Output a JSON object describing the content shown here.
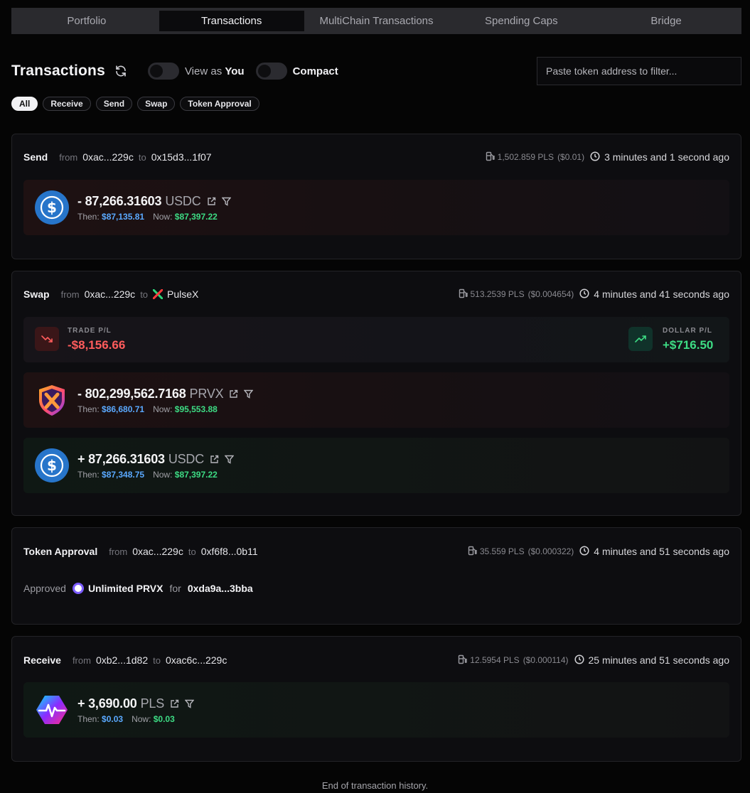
{
  "tabs": [
    {
      "label": "Portfolio",
      "active": false
    },
    {
      "label": "Transactions",
      "active": true
    },
    {
      "label": "MultiChain Transactions",
      "active": false
    },
    {
      "label": "Spending Caps",
      "active": false
    },
    {
      "label": "Bridge",
      "active": false
    }
  ],
  "header": {
    "title": "Transactions",
    "toggle_view_as_prefix": "View as ",
    "toggle_view_as_bold": "You",
    "toggle_compact": "Compact",
    "filter_placeholder": "Paste token address to filter..."
  },
  "filters": [
    {
      "label": "All",
      "active": true
    },
    {
      "label": "Receive",
      "active": false
    },
    {
      "label": "Send",
      "active": false
    },
    {
      "label": "Swap",
      "active": false
    },
    {
      "label": "Token Approval",
      "active": false
    }
  ],
  "labels": {
    "from": "from",
    "to": "to",
    "then": "Then:",
    "now": "Now:"
  },
  "colors": {
    "then": "#5aa9ff",
    "now": "#3ddc84",
    "negative": "#ff5c5c",
    "positive": "#3ddc84",
    "usdc": "#2775ca"
  },
  "transactions": [
    {
      "type": "Send",
      "from": "0xac...229c",
      "to": "0x15d3...1f07",
      "gas": "1,502.859 PLS",
      "gas_usd": "($0.01)",
      "time": "3 minutes and 1 second ago",
      "tokens": [
        {
          "amount": "- 87,266.31603",
          "symbol": "USDC",
          "then": "$87,135.81",
          "now": "$87,397.22",
          "icon": "usdc-icon"
        }
      ]
    },
    {
      "type": "Swap",
      "from": "0xac...229c",
      "to": "PulseX",
      "gas": "513.2539 PLS",
      "gas_usd": "($0.004654)",
      "time": "4 minutes and 41 seconds ago",
      "trade_pl_label": "TRADE P/L",
      "trade_pl": "-$8,156.66",
      "dollar_pl_label": "DOLLAR P/L",
      "dollar_pl": "+$716.50",
      "tokens": [
        {
          "amount": "- 802,299,562.7168",
          "symbol": "PRVX",
          "then": "$86,680.71",
          "now": "$95,553.88",
          "icon": "prvx-icon"
        },
        {
          "amount": "+ 87,266.31603",
          "symbol": "USDC",
          "then": "$87,348.75",
          "now": "$87,397.22",
          "icon": "usdc-icon"
        }
      ]
    },
    {
      "type": "Token Approval",
      "from": "0xac...229c",
      "to": "0xf6f8...0b11",
      "gas": "35.559 PLS",
      "gas_usd": "($0.000322)",
      "time": "4 minutes and 51 seconds ago",
      "approved_label": "Approved",
      "approved_amount": "Unlimited PRVX",
      "for_label": "for",
      "spender": "0xda9a...3bba"
    },
    {
      "type": "Receive",
      "from": "0xb2...1d82",
      "to": "0xac6c...229c",
      "gas": "12.5954 PLS",
      "gas_usd": "($0.000114)",
      "time": "25 minutes and 51 seconds ago",
      "tokens": [
        {
          "amount": "+ 3,690.00",
          "symbol": "PLS",
          "then": "$0.03",
          "now": "$0.03",
          "icon": "pls-icon"
        }
      ]
    }
  ],
  "footer": "End of transaction history."
}
